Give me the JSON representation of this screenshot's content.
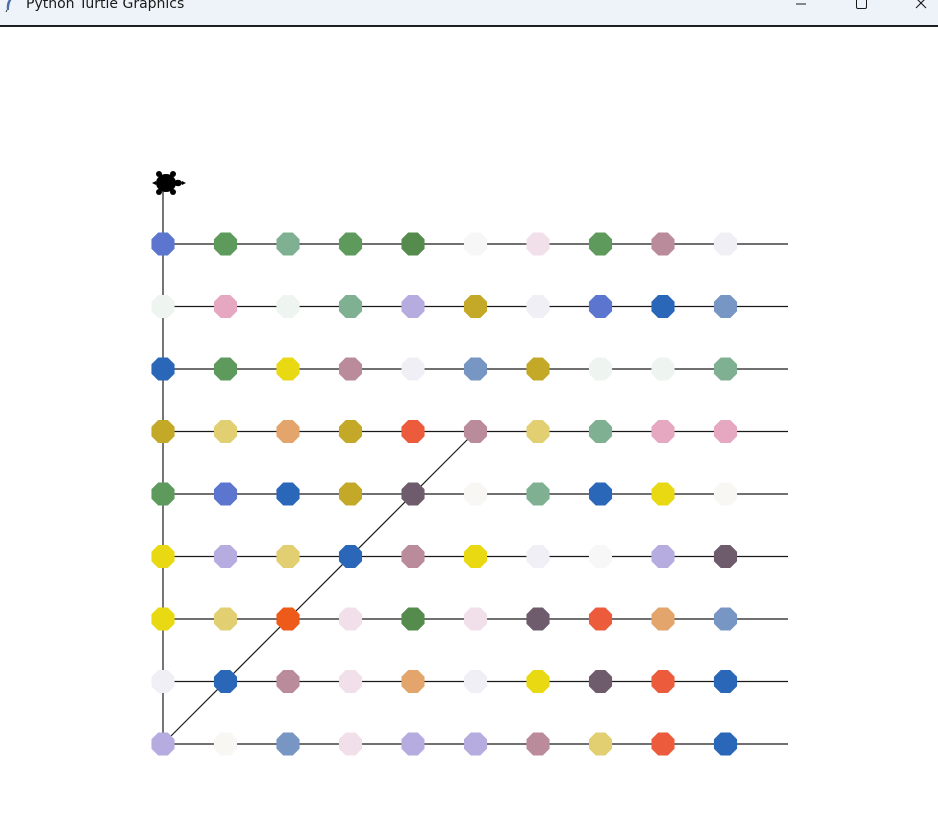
{
  "window": {
    "title": "Python Turtle Graphics",
    "app_icon": "python-feather-icon",
    "controls": {
      "minimize_icon": "minimize-icon",
      "maximize_icon": "maximize-icon",
      "close_icon": "close-icon"
    }
  },
  "canvas": {
    "background": "#ffffff",
    "line_color": "#1a1a1a",
    "turtle_icon": "turtle-icon",
    "dot_grid": [
      [
        "#5c76cf",
        "#5e9a5c",
        "#7fb091",
        "#5e9a5c",
        "#568b4e",
        "#f7f7f7",
        "#f1e0ea",
        "#5e9a5c",
        "#b98b9b",
        "#f0eff5"
      ],
      [
        "#eef4ef",
        "#e5a8c0",
        "#eef4ef",
        "#7fb091",
        "#b7acdf",
        "#c4a928",
        "#f0eff5",
        "#5c76cf",
        "#2a67b9",
        "#7896c4"
      ],
      [
        "#2a67b9",
        "#5e9a5c",
        "#e8d913",
        "#b98b9b",
        "#f0eff5",
        "#7896c4",
        "#c4a928",
        "#eef4ef",
        "#eef4ef",
        "#7fb091"
      ],
      [
        "#c4a928",
        "#e2cf72",
        "#e3a56b",
        "#c4a928",
        "#ec5c3c",
        "#b98b9b",
        "#e2cf72",
        "#7fb091",
        "#e5a8c0",
        "#e5a8c0"
      ],
      [
        "#5e9a5c",
        "#5c76cf",
        "#2a67b9",
        "#c4a928",
        "#6e5c6c",
        "#f8f7f4",
        "#7fb091",
        "#2a67b9",
        "#e8d913",
        "#f8f7f4"
      ],
      [
        "#e8d913",
        "#b7acdf",
        "#e2cf72",
        "#2a67b9",
        "#b98b9b",
        "#e8d913",
        "#f0eff5",
        "#f7f7f7",
        "#b7acdf",
        "#6e5c6c"
      ],
      [
        "#e8d913",
        "#e2cf72",
        "#ee5a19",
        "#f1e0ea",
        "#568b4e",
        "#f1e0ea",
        "#6e5c6c",
        "#ec5c3c",
        "#e3a56b",
        "#7896c4"
      ],
      [
        "#f0eff5",
        "#2a67b9",
        "#b98b9b",
        "#f1e0ea",
        "#e3a56b",
        "#f0eff5",
        "#e8d913",
        "#6e5c6c",
        "#ec5c3c",
        "#2a67b9"
      ],
      [
        "#b7acdf",
        "#f8f7f4",
        "#7896c4",
        "#f1e0ea",
        "#b7acdf",
        "#b7acdf",
        "#b98b9b",
        "#e2cf72",
        "#ec5c3c",
        "#2a67b9"
      ]
    ]
  }
}
